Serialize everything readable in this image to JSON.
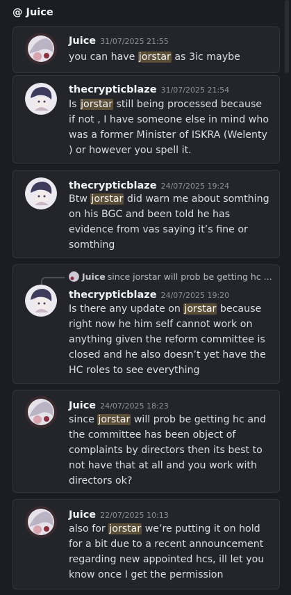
{
  "header": {
    "title": "@ Juice"
  },
  "messages": [
    {
      "author": "Juice",
      "time": "31/07/2025 21:55",
      "parts": [
        {
          "t": "you can have "
        },
        {
          "t": "jorstar",
          "hl": true
        },
        {
          "t": " as 3ic maybe"
        }
      ]
    },
    {
      "author": "thecrypticblaze",
      "time": "31/07/2025 21:54",
      "parts": [
        {
          "t": "Is "
        },
        {
          "t": "jorstar",
          "hl": true
        },
        {
          "t": " still being processed because if not , I have someone else in mind who was a former Minister of ISKRA (Welenty ) or however you spell it."
        }
      ]
    },
    {
      "author": "thecrypticblaze",
      "time": "24/07/2025 19:24",
      "parts": [
        {
          "t": "Btw "
        },
        {
          "t": "jorstar",
          "hl": true
        },
        {
          "t": " did warn me about somthing on his BGC and been told he has evidence from vas saying it’s fine or somthing"
        }
      ]
    },
    {
      "author": "thecrypticblaze",
      "time": "24/07/2025 19:20",
      "reply": {
        "author": "Juice",
        "text": "since jorstar will prob be getting hc ..."
      },
      "parts": [
        {
          "t": "Is there any update on "
        },
        {
          "t": "jorstar",
          "hl": true
        },
        {
          "t": " because right now he him self cannot work on anything given the reform committee is closed and he also doesn’t yet have the HC roles to see everything"
        }
      ]
    },
    {
      "author": "Juice",
      "time": "24/07/2025 18:23",
      "parts": [
        {
          "t": "since "
        },
        {
          "t": "jorstar",
          "hl": true
        },
        {
          "t": " will prob be getting hc and the committee has been object of complaints by directors then its best to not have that at all and you work with directors ok?"
        }
      ]
    },
    {
      "author": "Juice",
      "time": "22/07/2025 10:13",
      "parts": [
        {
          "t": "also for "
        },
        {
          "t": "jorstar",
          "hl": true
        },
        {
          "t": " we’re putting it on hold for a bit due to a recent announcement regarding new appointed hcs, ill let you know once I get the permission"
        }
      ]
    }
  ]
}
